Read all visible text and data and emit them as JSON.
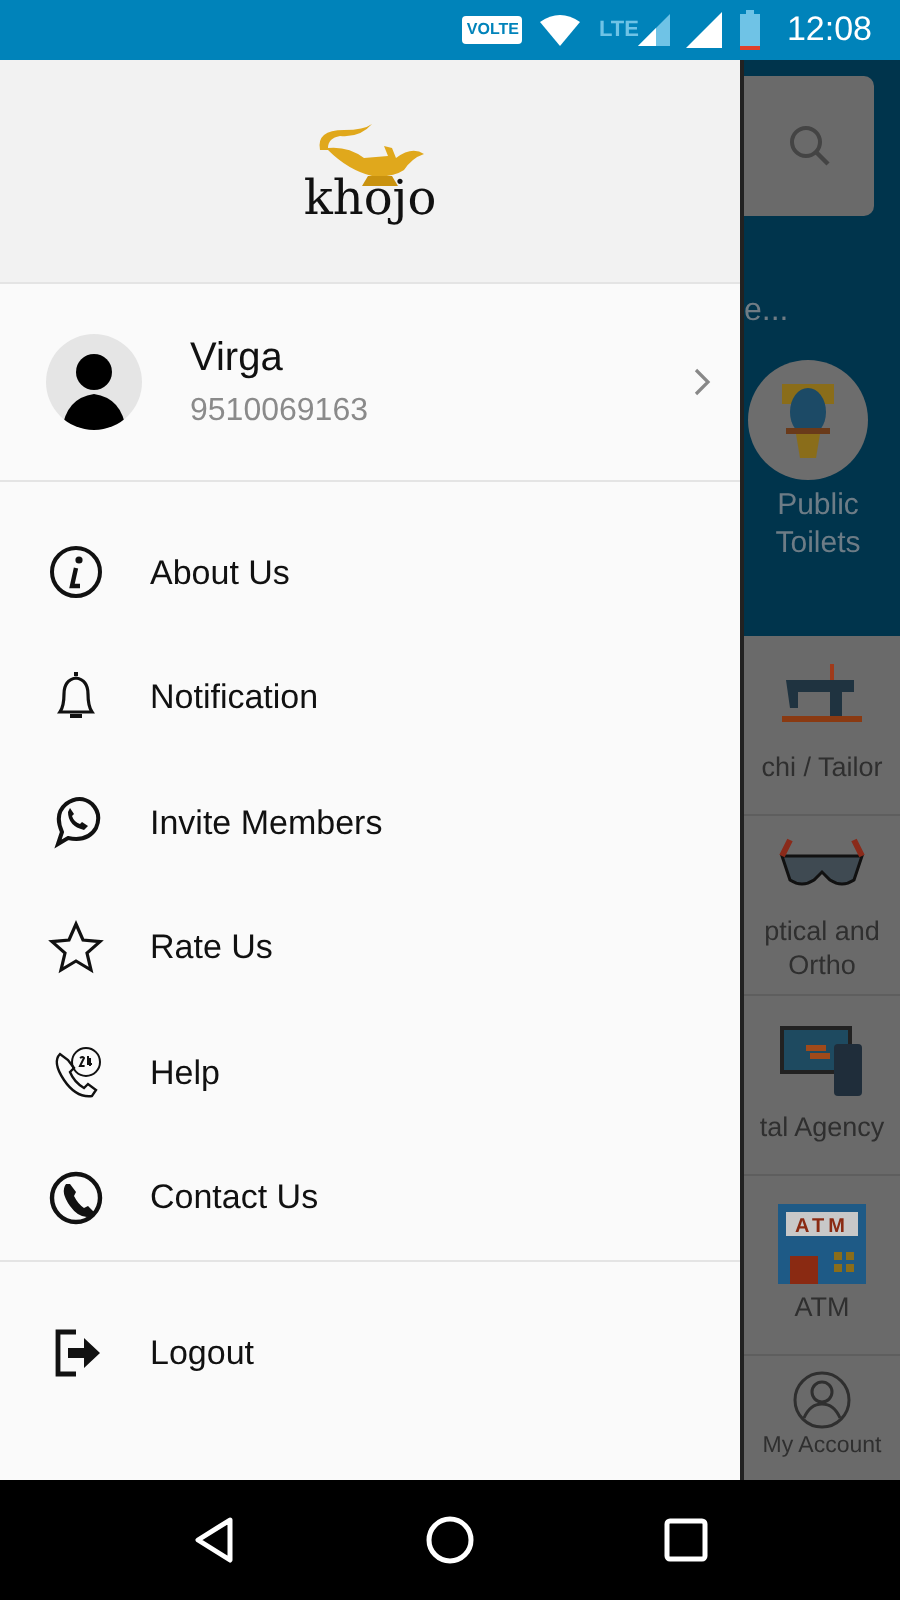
{
  "status_bar": {
    "volte": "VOLTE",
    "network": "LTE",
    "time": "12:08"
  },
  "drawer": {
    "logo": "khojo",
    "profile": {
      "name": "Virga",
      "phone": "9510069163"
    },
    "menu": [
      {
        "label": "About Us"
      },
      {
        "label": "Notification"
      },
      {
        "label": "Invite Members"
      },
      {
        "label": "Rate Us"
      },
      {
        "label": "Help"
      },
      {
        "label": "Contact Us"
      }
    ],
    "footer_menu": [
      {
        "label": "Logout"
      }
    ]
  },
  "background": {
    "search_hint": "e...",
    "featured": {
      "label": "Public Toilets"
    },
    "categories": [
      {
        "label": "chi / Tailor"
      },
      {
        "label": "ptical and Ortho"
      },
      {
        "label": "tal Agency"
      },
      {
        "label": "ATM",
        "sign": "ATM"
      }
    ],
    "account": "My Account"
  }
}
